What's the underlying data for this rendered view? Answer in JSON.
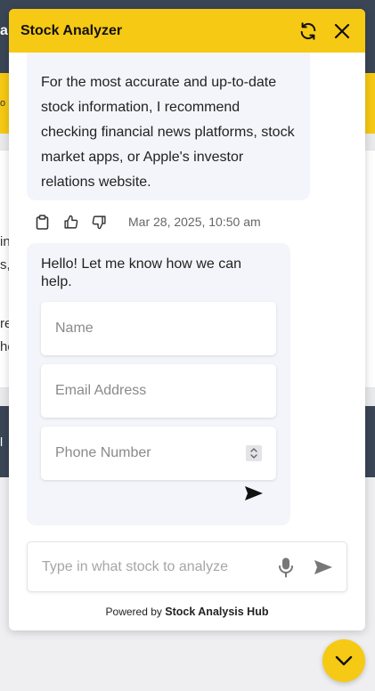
{
  "background": {
    "header_fragment": "a",
    "banner_fragment": "o",
    "card_lines": [
      "in",
      "s,",
      "",
      "re",
      "he"
    ],
    "footer_fragment": "l"
  },
  "widget": {
    "title": "Stock Analyzer",
    "refresh_icon": "refresh-icon",
    "close_icon": "close-icon"
  },
  "bot_message": {
    "text": "For the most accurate and up-to-date stock information, I recommend checking financial news platforms, stock market apps, or Apple's investor relations website.",
    "timestamp": "Mar 28, 2025, 10:50 am"
  },
  "contact_form": {
    "greeting": "Hello! Let me know how we can help.",
    "name_placeholder": "Name",
    "email_placeholder": "Email Address",
    "phone_placeholder": "Phone Number"
  },
  "composer": {
    "placeholder": "Type in what stock to analyze"
  },
  "footer": {
    "powered_prefix": "Powered by",
    "powered_brand": "Stock Analysis Hub"
  },
  "colors": {
    "accent": "#f6c914",
    "dark_nav": "#3a4556",
    "bubble": "#f4f5fb"
  }
}
